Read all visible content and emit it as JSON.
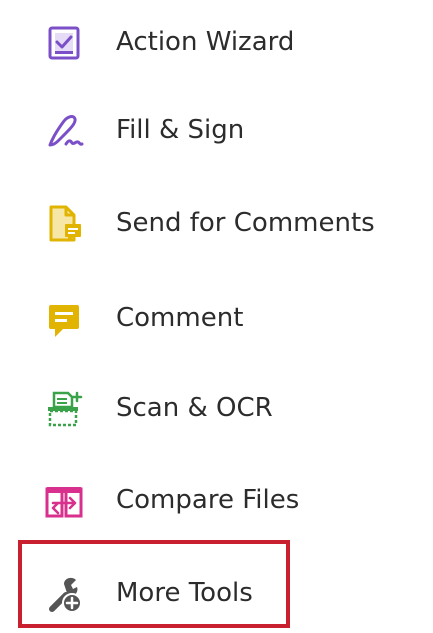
{
  "tools": {
    "items": [
      {
        "label": "Action Wizard",
        "icon": "action-wizard-icon",
        "color": "#7b4fc8"
      },
      {
        "label": "Fill & Sign",
        "icon": "fill-sign-icon",
        "color": "#7b4fc8"
      },
      {
        "label": "Send for Comments",
        "icon": "send-for-comments-icon",
        "color": "#e0b400"
      },
      {
        "label": "Comment",
        "icon": "comment-icon",
        "color": "#e0b400"
      },
      {
        "label": "Scan & OCR",
        "icon": "scan-ocr-icon",
        "color": "#3aa34a"
      },
      {
        "label": "Compare Files",
        "icon": "compare-files-icon",
        "color": "#d8308c"
      },
      {
        "label": "More Tools",
        "icon": "more-tools-icon",
        "color": "#555555"
      }
    ]
  },
  "highlight": {
    "target": "More Tools",
    "color": "#c8202f"
  }
}
